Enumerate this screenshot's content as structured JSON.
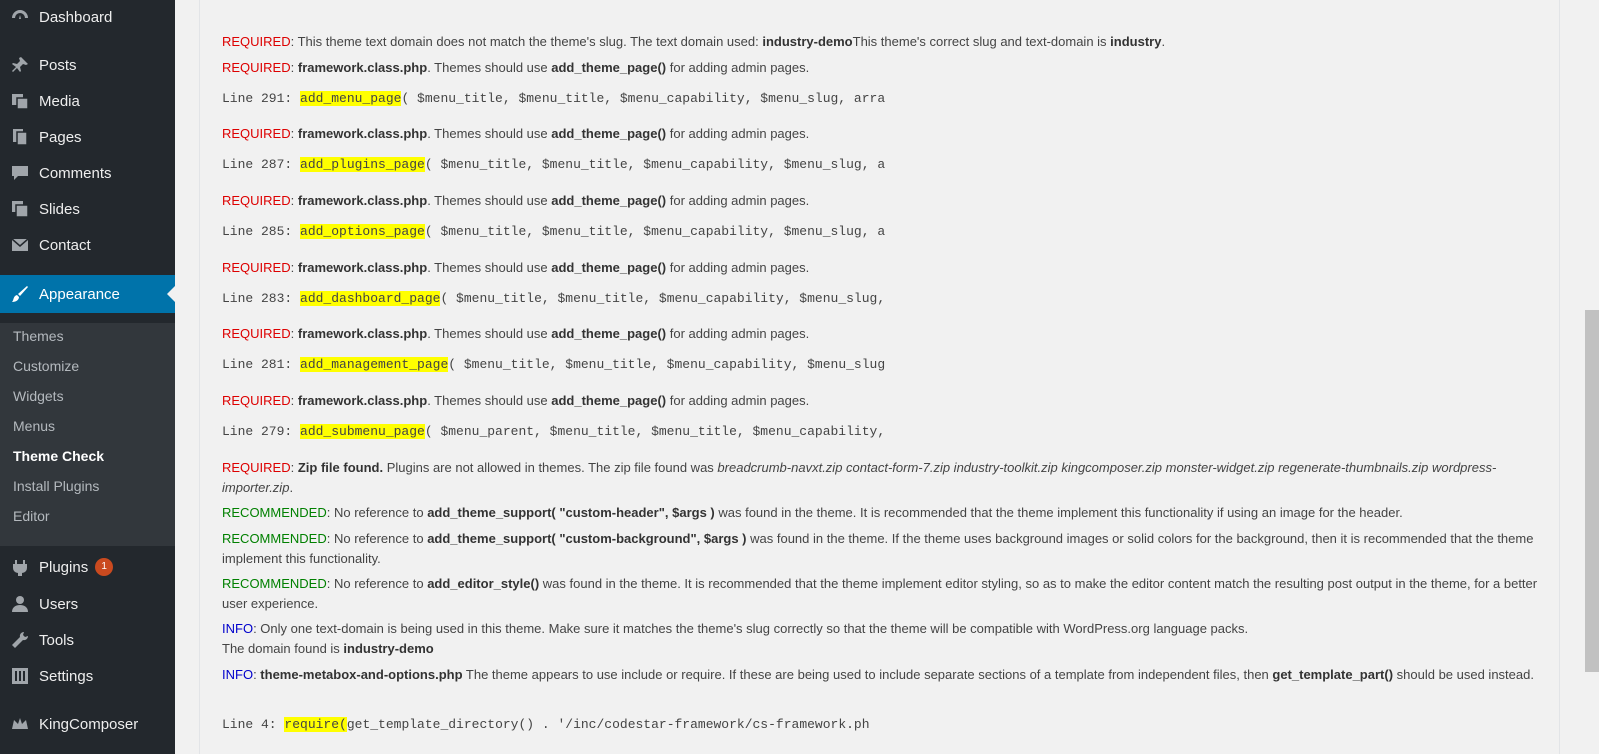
{
  "sidebar": {
    "dashboard": "Dashboard",
    "posts": "Posts",
    "media": "Media",
    "pages": "Pages",
    "comments": "Comments",
    "slides": "Slides",
    "contact": "Contact",
    "appearance": "Appearance",
    "submenu": {
      "themes": "Themes",
      "customize": "Customize",
      "widgets": "Widgets",
      "menus": "Menus",
      "theme_check": "Theme Check",
      "install_plugins": "Install Plugins",
      "editor": "Editor"
    },
    "plugins": "Plugins",
    "plugins_badge": "1",
    "users": "Users",
    "tools": "Tools",
    "settings": "Settings",
    "kingcomposer": "KingComposer"
  },
  "labels": {
    "required": "REQUIRED",
    "recommended": "RECOMMENDED",
    "info": "INFO"
  },
  "messages": {
    "m1_a": ": This theme text domain does not match the theme's slug. The text domain used: ",
    "m1_b": "industry-demo",
    "m1_c": "This theme's correct slug and text-domain is ",
    "m1_d": "industry",
    "m1_e": ".",
    "fw_file": "framework.class.php",
    "fw_a": ". Themes should use ",
    "fw_func": "add_theme_page()",
    "fw_b": " for adding admin pages.",
    "zip_a": "Zip file found.",
    "zip_b": " Plugins are not allowed in themes. The zip file found was ",
    "zip_files": "breadcrumb-navxt.zip contact-form-7.zip industry-toolkit.zip kingcomposer.zip monster-widget.zip regenerate-thumbnails.zip wordpress-importer.zip",
    "zip_c": ".",
    "rec1_a": ": No reference to ",
    "rec1_b": "add_theme_support( \"custom-header\", $args )",
    "rec1_c": " was found in the theme. It is recommended that the theme implement this functionality if using an image for the header.",
    "rec2_a": ": No reference to ",
    "rec2_b": "add_theme_support( \"custom-background\", $args )",
    "rec2_c": " was found in the theme. If the theme uses background images or solid colors for the background, then it is recommended that the theme implement this functionality.",
    "rec3_a": ": No reference to ",
    "rec3_b": "add_editor_style()",
    "rec3_c": " was found in the theme. It is recommended that the theme implement editor styling, so as to make the editor content match the resulting post output in the theme, for a better user experience.",
    "info1_a": ": Only one text-domain is being used in this theme. Make sure it matches the theme's slug correctly so that the theme will be compatible with WordPress.org language packs.",
    "info1_b": "The domain found is ",
    "info1_c": "industry-demo",
    "info2_a": "theme-metabox-and-options.php",
    "info2_b": " The theme appears to use include or require. If these are being used to include separate sections of a template from independent files, then ",
    "info2_c": "get_template_part()",
    "info2_d": " should be used instead."
  },
  "code_lines": {
    "l291_pre": "Line 291: ",
    "l291_fn": "add_menu_page",
    "l291_post": "( $menu_title, $menu_title, $menu_capability, $menu_slug, arra",
    "l287_pre": "Line 287: ",
    "l287_fn": "add_plugins_page",
    "l287_post": "( $menu_title, $menu_title, $menu_capability, $menu_slug, a",
    "l285_pre": "Line 285: ",
    "l285_fn": "add_options_page",
    "l285_post": "( $menu_title, $menu_title, $menu_capability, $menu_slug, a",
    "l283_pre": "Line 283: ",
    "l283_fn": "add_dashboard_page",
    "l283_post": "( $menu_title, $menu_title, $menu_capability, $menu_slug,",
    "l281_pre": "Line 281: ",
    "l281_fn": "add_management_page",
    "l281_post": "( $menu_title, $menu_title, $menu_capability, $menu_slug",
    "l279_pre": "Line 279: ",
    "l279_fn": "add_submenu_page",
    "l279_post": "( $menu_parent, $menu_title, $menu_title, $menu_capability,",
    "l4_pre": "Line 4: ",
    "l4_fn": "require(",
    "l4_post": "get_template_directory() . '/inc/codestar-framework/cs-framework.ph"
  },
  "colors": {
    "required": "#dd0000",
    "recommended": "#008000",
    "info": "#0000cc",
    "highlight": "#ffff00",
    "sidebar_bg": "#23282d",
    "active_bg": "#0073aa",
    "badge_bg": "#ca4a1f"
  },
  "icons": [
    "dashboard-icon",
    "pushpin-icon",
    "media-icon",
    "pages-icon",
    "comments-icon",
    "slides-icon",
    "email-icon",
    "paintbrush-icon",
    "plugins-icon",
    "users-icon",
    "tools-icon",
    "settings-icon",
    "kingcomposer-icon"
  ]
}
